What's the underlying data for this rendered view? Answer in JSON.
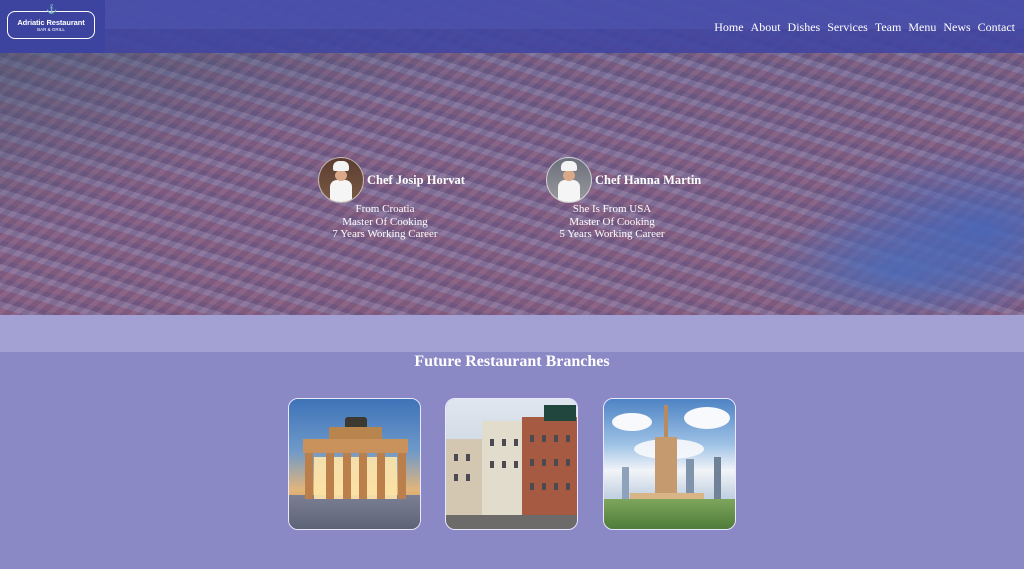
{
  "brand": {
    "name": "Adriatic Restaurant",
    "subtitle": "BAR & GRILL",
    "small_text": "FRESH SEAFOOD SINCE"
  },
  "nav": {
    "items": [
      "Home",
      "About",
      "Dishes",
      "Services",
      "Team",
      "Menu",
      "News",
      "Contact"
    ]
  },
  "team": {
    "chefs": [
      {
        "name": "Chef Josip Horvat",
        "lines": [
          "From Croatia",
          "Master Of Cooking",
          "7 Years Working Career"
        ]
      },
      {
        "name": "Chef Hanna Martin",
        "lines": [
          "She Is From USA",
          "Master Of Cooking",
          "5 Years Working Career"
        ]
      }
    ]
  },
  "branches": {
    "title": "Future Restaurant Branches",
    "images": [
      "gate-photo",
      "street-photo",
      "city-tower-photo"
    ]
  },
  "colors": {
    "nav_bg": "#4044a2",
    "logo_bg": "#3c44a0",
    "section_bg": "#8b88c6",
    "band_bg": "#a3a1d4",
    "text": "#ffffff"
  }
}
